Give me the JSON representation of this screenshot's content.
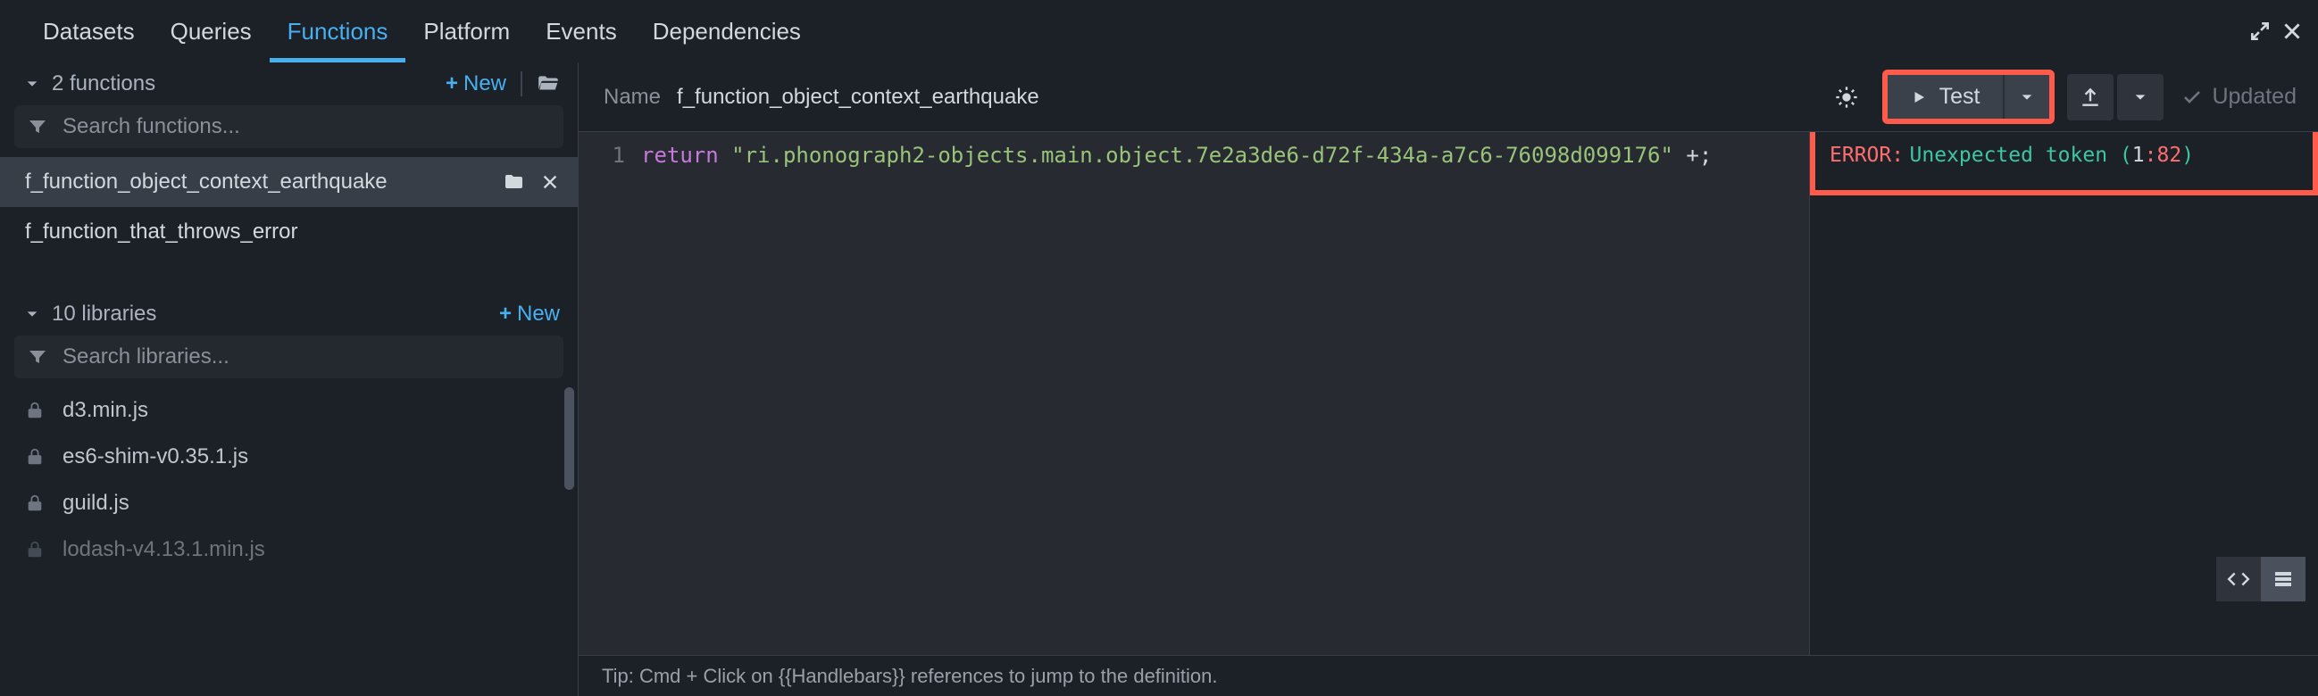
{
  "tabs": [
    "Datasets",
    "Queries",
    "Functions",
    "Platform",
    "Events",
    "Dependencies"
  ],
  "active_tab_index": 2,
  "sidebar": {
    "functions_header": "2 functions",
    "new_label": "New",
    "search_functions_placeholder": "Search functions...",
    "functions": [
      {
        "name": "f_function_object_context_earthquake",
        "active": true
      },
      {
        "name": "f_function_that_throws_error",
        "active": false
      }
    ],
    "libraries_header": "10 libraries",
    "search_libraries_placeholder": "Search libraries...",
    "libraries": [
      "d3.min.js",
      "es6-shim-v0.35.1.js",
      "guild.js",
      "lodash-v4.13.1.min.js"
    ]
  },
  "editor": {
    "name_label": "Name",
    "name_value": "f_function_object_context_earthquake",
    "test_label": "Test",
    "updated_label": "Updated",
    "line_number": "1",
    "code": {
      "keyword": "return",
      "string": "\"ri.phonograph2-objects.main.object.7e2a3de6-d72f-434a-a7c6-76098d099176\"",
      "tail": " +;"
    },
    "tip": "Tip: Cmd + Click on {{Handlebars}} references to jump to the definition."
  },
  "error": {
    "label": "ERROR",
    "message": "Unexpected token",
    "loc_open": "(",
    "loc_line": "1",
    "loc_sep": ":",
    "loc_col": "82",
    "loc_close": ")"
  }
}
